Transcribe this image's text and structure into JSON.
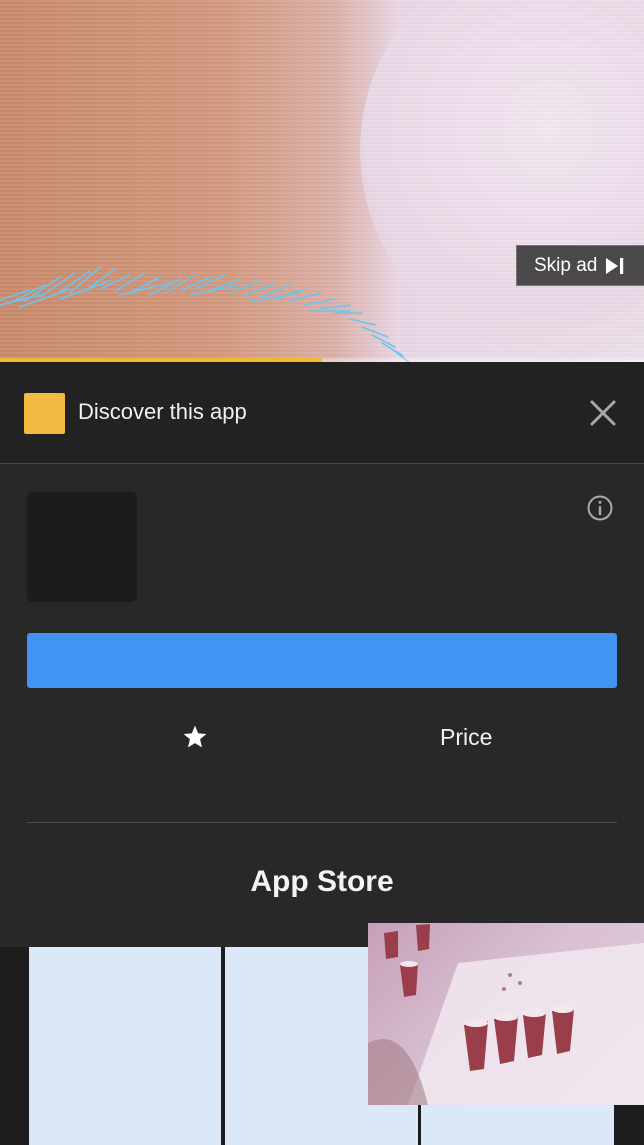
{
  "video": {
    "progress_fraction": 0.5
  },
  "skip_button": {
    "label": "Skip ad",
    "icon": "skip-next-icon"
  },
  "header": {
    "title": "Discover this app",
    "close_icon": "close-icon",
    "badge_color": "#F1BB43"
  },
  "card": {
    "info_icon": "info-icon",
    "install_button_label": "",
    "install_button_color": "#4194F4",
    "rating_icon": "star-icon",
    "price_label": "Price",
    "store_label": "App Store"
  },
  "screenshots": {
    "count": 3
  }
}
